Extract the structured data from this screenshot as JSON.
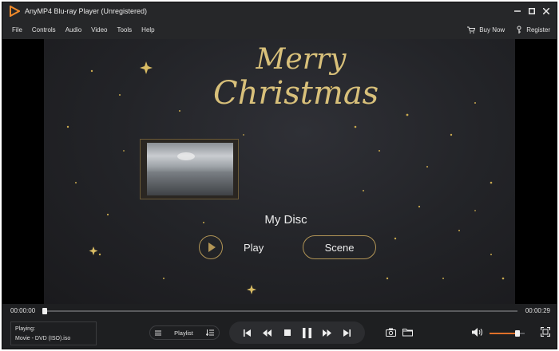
{
  "window": {
    "title": "AnyMP4 Blu-ray Player (Unregistered)"
  },
  "menu": {
    "items": [
      {
        "label": "File"
      },
      {
        "label": "Controls"
      },
      {
        "label": "Audio"
      },
      {
        "label": "Video"
      },
      {
        "label": "Tools"
      },
      {
        "label": "Help"
      }
    ],
    "buy_now": "Buy Now",
    "register": "Register"
  },
  "disc_menu": {
    "greeting_line1": "Merry",
    "greeting_line2": "Christmas",
    "title": "My Disc",
    "play_label": "Play",
    "scene_label": "Scene"
  },
  "progress": {
    "current_time": "00:00:00",
    "total_time": "00:00:29",
    "fraction": 0.0
  },
  "now_playing": {
    "label": "Playing:",
    "file": "Movie - DVD (ISO).iso"
  },
  "playlist": {
    "label": "Playlist"
  },
  "volume": {
    "level": 0.8
  },
  "colors": {
    "accent": "#e0702a",
    "gold": "#b29556",
    "background": "#1e1f21"
  }
}
